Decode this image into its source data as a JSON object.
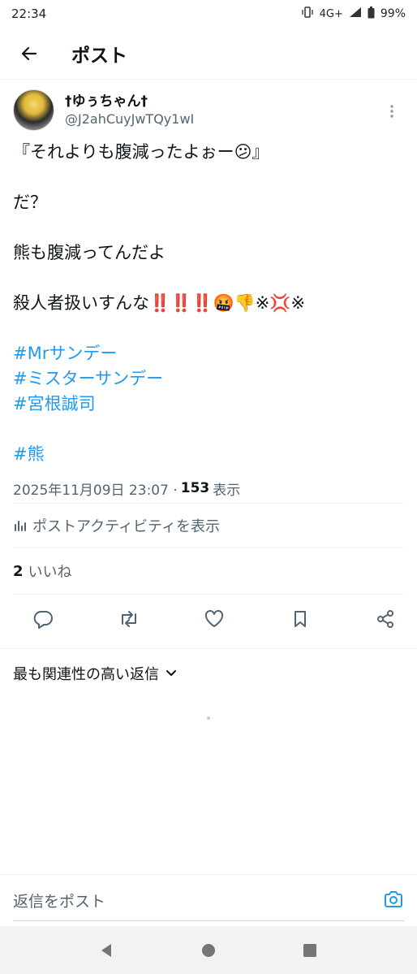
{
  "status_bar": {
    "time": "22:34",
    "network": "4G+",
    "battery": "99%",
    "icons": [
      "vibrate-icon",
      "signal-icon",
      "battery-icon"
    ]
  },
  "header": {
    "back_icon": "arrow-left-icon",
    "title": "ポスト"
  },
  "post": {
    "display_name": "†ゆぅちゃん†",
    "handle": "@J2ahCuyJwTQy1wI",
    "lines": [
      "『それよりも腹減ったよぉー😕』",
      "だ？",
      "熊も腹減ってんだよ",
      "殺人者扱いすんな‼️‼️‼️🤬👎※💢※"
    ],
    "hashtags": [
      "#Mrサンデー",
      "#ミスターサンデー",
      "#宮根誠司"
    ],
    "last_hashtag": "#熊",
    "timestamp": "2025年11月09日 23:07 ·",
    "views_count": "153",
    "views_label": "表示",
    "activity_label": "ポストアクティビティを表示",
    "likes_count": "2",
    "likes_label": "いいね"
  },
  "sort": {
    "label": "最も関連性の高い返信"
  },
  "reply": {
    "placeholder": "返信をポスト"
  },
  "colors": {
    "accent": "#1d9bf0",
    "text": "#0f1419",
    "secondary": "#536471",
    "divider": "#eff3f4"
  }
}
